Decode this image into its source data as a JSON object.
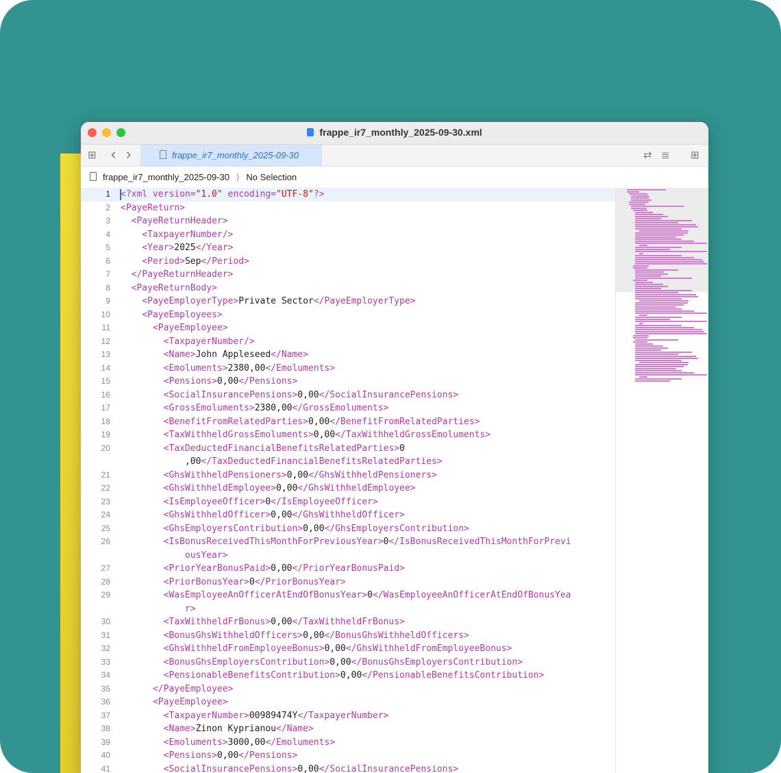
{
  "window": {
    "title": "frappe_ir7_monthly_2025-09-30.xml"
  },
  "tab": {
    "label": "frappe_ir7_monthly_2025-09-30"
  },
  "jumpbar": {
    "file": "frappe_ir7_monthly_2025-09-30",
    "separator": "⟩",
    "selection": "No Selection"
  },
  "icons": {
    "grid": "⊞",
    "back": "‹",
    "forward": "›",
    "swap": "⇄",
    "lines": "≣",
    "inspector": "⊞"
  },
  "colors": {
    "background": "#329390",
    "accent": "#2a6fd6",
    "tag": "#ad3da4",
    "string": "#c41a16"
  },
  "lines": [
    {
      "n": "1",
      "indent": "",
      "segs": [
        [
          "tag",
          "<?xml version="
        ],
        [
          "str",
          "\"1.0\""
        ],
        [
          "tag",
          " encoding="
        ],
        [
          "str",
          "\"UTF-8\""
        ],
        [
          "tag",
          "?>"
        ]
      ]
    },
    {
      "n": "2",
      "indent": "",
      "segs": [
        [
          "tag",
          "<PayeReturn>"
        ]
      ]
    },
    {
      "n": "3",
      "indent": "  ",
      "segs": [
        [
          "tag",
          "<PayeReturnHeader>"
        ]
      ]
    },
    {
      "n": "4",
      "indent": "    ",
      "segs": [
        [
          "tag",
          "<TaxpayerNumber/>"
        ]
      ]
    },
    {
      "n": "5",
      "indent": "    ",
      "segs": [
        [
          "tag",
          "<Year>"
        ],
        [
          "txt",
          "2025"
        ],
        [
          "tag",
          "</Year>"
        ]
      ]
    },
    {
      "n": "6",
      "indent": "    ",
      "segs": [
        [
          "tag",
          "<Period>"
        ],
        [
          "txt",
          "Sep"
        ],
        [
          "tag",
          "</Period>"
        ]
      ]
    },
    {
      "n": "7",
      "indent": "  ",
      "segs": [
        [
          "tag",
          "</PayeReturnHeader>"
        ]
      ]
    },
    {
      "n": "8",
      "indent": "  ",
      "segs": [
        [
          "tag",
          "<PayeReturnBody>"
        ]
      ]
    },
    {
      "n": "9",
      "indent": "    ",
      "segs": [
        [
          "tag",
          "<PayeEmployerType>"
        ],
        [
          "txt",
          "Private Sector"
        ],
        [
          "tag",
          "</PayeEmployerType>"
        ]
      ]
    },
    {
      "n": "10",
      "indent": "    ",
      "segs": [
        [
          "tag",
          "<PayeEmployees>"
        ]
      ]
    },
    {
      "n": "11",
      "indent": "      ",
      "segs": [
        [
          "tag",
          "<PayeEmployee>"
        ]
      ]
    },
    {
      "n": "12",
      "indent": "        ",
      "segs": [
        [
          "tag",
          "<TaxpayerNumber/>"
        ]
      ]
    },
    {
      "n": "13",
      "indent": "        ",
      "segs": [
        [
          "tag",
          "<Name>"
        ],
        [
          "txt",
          "John Appleseed"
        ],
        [
          "tag",
          "</Name>"
        ]
      ]
    },
    {
      "n": "14",
      "indent": "        ",
      "segs": [
        [
          "tag",
          "<Emoluments>"
        ],
        [
          "txt",
          "2380,00"
        ],
        [
          "tag",
          "</Emoluments>"
        ]
      ]
    },
    {
      "n": "15",
      "indent": "        ",
      "segs": [
        [
          "tag",
          "<Pensions>"
        ],
        [
          "txt",
          "0,00"
        ],
        [
          "tag",
          "</Pensions>"
        ]
      ]
    },
    {
      "n": "16",
      "indent": "        ",
      "segs": [
        [
          "tag",
          "<SocialInsurancePensions>"
        ],
        [
          "txt",
          "0,00"
        ],
        [
          "tag",
          "</SocialInsurancePensions>"
        ]
      ]
    },
    {
      "n": "17",
      "indent": "        ",
      "segs": [
        [
          "tag",
          "<GrossEmoluments>"
        ],
        [
          "txt",
          "2380,00"
        ],
        [
          "tag",
          "</GrossEmoluments>"
        ]
      ]
    },
    {
      "n": "18",
      "indent": "        ",
      "segs": [
        [
          "tag",
          "<BenefitFromRelatedParties>"
        ],
        [
          "txt",
          "0,00"
        ],
        [
          "tag",
          "</BenefitFromRelatedParties>"
        ]
      ]
    },
    {
      "n": "19",
      "indent": "        ",
      "segs": [
        [
          "tag",
          "<TaxWithheldGrossEmoluments>"
        ],
        [
          "txt",
          "0,00"
        ],
        [
          "tag",
          "</TaxWithheldGrossEmoluments>"
        ]
      ]
    },
    {
      "n": "20",
      "indent": "        ",
      "segs": [
        [
          "tag",
          "<TaxDeductedFinancialBenefitsRelatedParties>"
        ],
        [
          "txt",
          "0"
        ]
      ]
    },
    {
      "n": "",
      "indent": "            ",
      "segs": [
        [
          "txt",
          ",00"
        ],
        [
          "tag",
          "</TaxDeductedFinancialBenefitsRelatedParties>"
        ]
      ]
    },
    {
      "n": "21",
      "indent": "        ",
      "segs": [
        [
          "tag",
          "<GhsWithheldPensioners>"
        ],
        [
          "txt",
          "0,00"
        ],
        [
          "tag",
          "</GhsWithheldPensioners>"
        ]
      ]
    },
    {
      "n": "22",
      "indent": "        ",
      "segs": [
        [
          "tag",
          "<GhsWithheldEmployee>"
        ],
        [
          "txt",
          "0,00"
        ],
        [
          "tag",
          "</GhsWithheldEmployee>"
        ]
      ]
    },
    {
      "n": "23",
      "indent": "        ",
      "segs": [
        [
          "tag",
          "<IsEmployeeOfficer>"
        ],
        [
          "txt",
          "0"
        ],
        [
          "tag",
          "</IsEmployeeOfficer>"
        ]
      ]
    },
    {
      "n": "24",
      "indent": "        ",
      "segs": [
        [
          "tag",
          "<GhsWithheldOfficer>"
        ],
        [
          "txt",
          "0,00"
        ],
        [
          "tag",
          "</GhsWithheldOfficer>"
        ]
      ]
    },
    {
      "n": "25",
      "indent": "        ",
      "segs": [
        [
          "tag",
          "<GhsEmployersContribution>"
        ],
        [
          "txt",
          "0,00"
        ],
        [
          "tag",
          "</GhsEmployersContribution>"
        ]
      ]
    },
    {
      "n": "26",
      "indent": "        ",
      "segs": [
        [
          "tag",
          "<IsBonusReceivedThisMonthForPreviousYear>"
        ],
        [
          "txt",
          "0"
        ],
        [
          "tag",
          "</IsBonusReceivedThisMonthForPrevi"
        ]
      ]
    },
    {
      "n": "",
      "indent": "            ",
      "segs": [
        [
          "tag",
          "ousYear>"
        ]
      ]
    },
    {
      "n": "27",
      "indent": "        ",
      "segs": [
        [
          "tag",
          "<PriorYearBonusPaid>"
        ],
        [
          "txt",
          "0,00"
        ],
        [
          "tag",
          "</PriorYearBonusPaid>"
        ]
      ]
    },
    {
      "n": "28",
      "indent": "        ",
      "segs": [
        [
          "tag",
          "<PriorBonusYear>"
        ],
        [
          "txt",
          "0"
        ],
        [
          "tag",
          "</PriorBonusYear>"
        ]
      ]
    },
    {
      "n": "29",
      "indent": "        ",
      "segs": [
        [
          "tag",
          "<WasEmployeeAnOfficerAtEndOfBonusYear>"
        ],
        [
          "txt",
          "0"
        ],
        [
          "tag",
          "</WasEmployeeAnOfficerAtEndOfBonusYea"
        ]
      ]
    },
    {
      "n": "",
      "indent": "            ",
      "segs": [
        [
          "tag",
          "r>"
        ]
      ]
    },
    {
      "n": "30",
      "indent": "        ",
      "segs": [
        [
          "tag",
          "<TaxWithheldFrBonus>"
        ],
        [
          "txt",
          "0,00"
        ],
        [
          "tag",
          "</TaxWithheldFrBonus>"
        ]
      ]
    },
    {
      "n": "31",
      "indent": "        ",
      "segs": [
        [
          "tag",
          "<BonusGhsWithheldOfficers>"
        ],
        [
          "txt",
          "0,00"
        ],
        [
          "tag",
          "</BonusGhsWithheldOfficers>"
        ]
      ]
    },
    {
      "n": "32",
      "indent": "        ",
      "segs": [
        [
          "tag",
          "<GhsWithheldFromEmployeeBonus>"
        ],
        [
          "txt",
          "0,00"
        ],
        [
          "tag",
          "</GhsWithheldFromEmployeeBonus>"
        ]
      ]
    },
    {
      "n": "33",
      "indent": "        ",
      "segs": [
        [
          "tag",
          "<BonusGhsEmployersContribution>"
        ],
        [
          "txt",
          "0,00"
        ],
        [
          "tag",
          "</BonusGhsEmployersContribution>"
        ]
      ]
    },
    {
      "n": "34",
      "indent": "        ",
      "segs": [
        [
          "tag",
          "<PensionableBenefitsContribution>"
        ],
        [
          "txt",
          "0,00"
        ],
        [
          "tag",
          "</PensionableBenefitsContribution>"
        ]
      ]
    },
    {
      "n": "35",
      "indent": "      ",
      "segs": [
        [
          "tag",
          "</PayeEmployee>"
        ]
      ]
    },
    {
      "n": "36",
      "indent": "      ",
      "segs": [
        [
          "tag",
          "<PayeEmployee>"
        ]
      ]
    },
    {
      "n": "37",
      "indent": "        ",
      "segs": [
        [
          "tag",
          "<TaxpayerNumber>"
        ],
        [
          "txt",
          "00989474Y"
        ],
        [
          "tag",
          "</TaxpayerNumber>"
        ]
      ]
    },
    {
      "n": "38",
      "indent": "        ",
      "segs": [
        [
          "tag",
          "<Name>"
        ],
        [
          "txt",
          "Zinon Kyprianou"
        ],
        [
          "tag",
          "</Name>"
        ]
      ]
    },
    {
      "n": "39",
      "indent": "        ",
      "segs": [
        [
          "tag",
          "<Emoluments>"
        ],
        [
          "txt",
          "3000,00"
        ],
        [
          "tag",
          "</Emoluments>"
        ]
      ]
    },
    {
      "n": "40",
      "indent": "        ",
      "segs": [
        [
          "tag",
          "<Pensions>"
        ],
        [
          "txt",
          "0,00"
        ],
        [
          "tag",
          "</Pensions>"
        ]
      ]
    },
    {
      "n": "41",
      "indent": "        ",
      "segs": [
        [
          "tag",
          "<SocialInsurancePensions>"
        ],
        [
          "txt",
          "0,00"
        ],
        [
          "tag",
          "</SocialInsurancePensions>"
        ]
      ]
    }
  ]
}
